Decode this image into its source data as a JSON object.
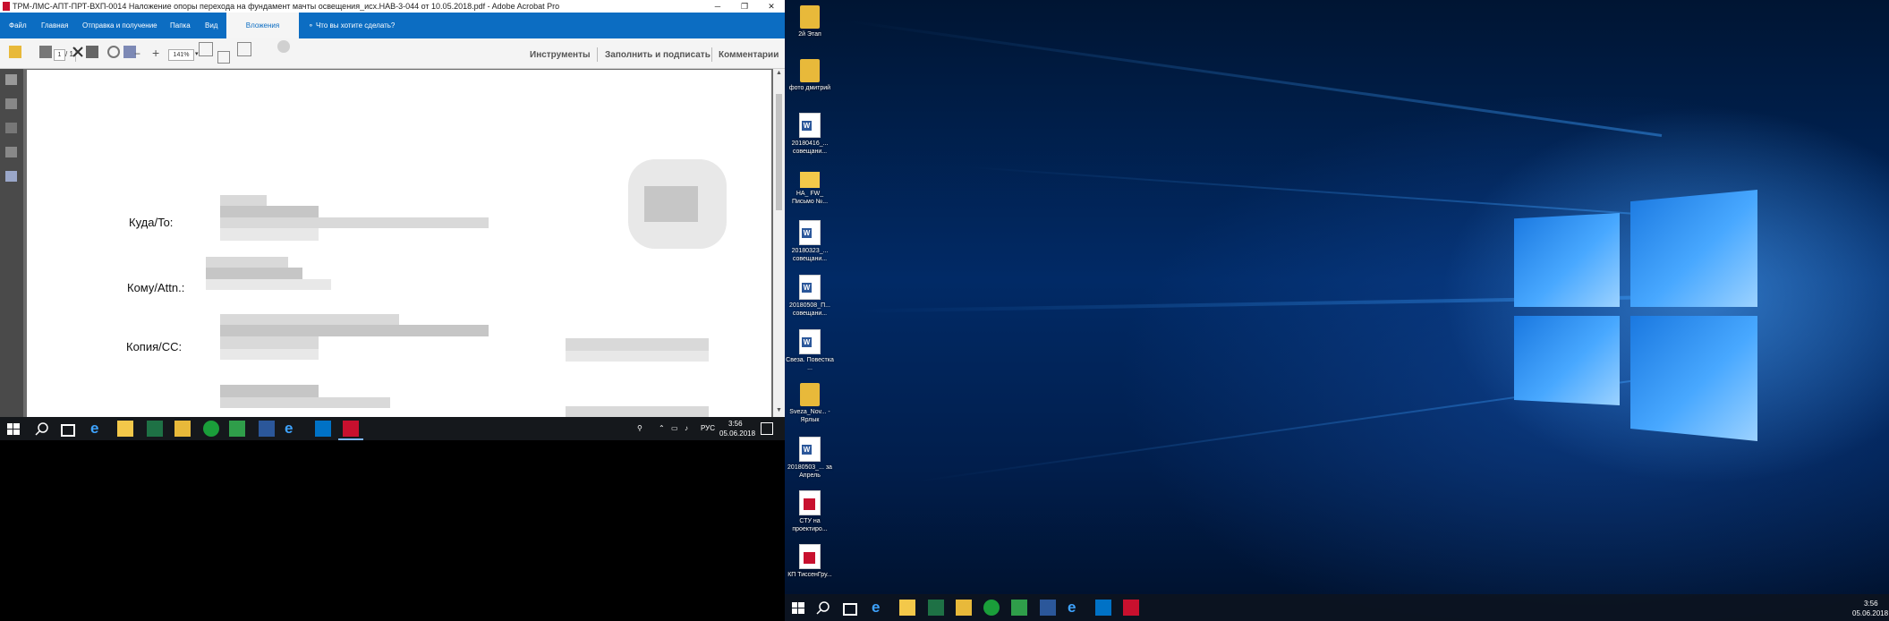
{
  "acrobat": {
    "title": "ТРМ-ЛМС-АПТ-ПРТ-ВХП-0014 Наложение опоры перехода на фундамент мачты освещения_исх.НАВ-3-044 от 10.05.2018.pdf - Adobe Acrobat Pro",
    "menu": [
      "Файл",
      "Главная",
      "Отправка и получение",
      "Папка",
      "Вид",
      "Вложения"
    ],
    "active_tab": "Вложения",
    "help_search": "Что вы хотите сделать?",
    "page_count": "/ 1",
    "zoom": "141%",
    "panels": [
      "Инструменты",
      "Заполнить и подписать",
      "Комментарии"
    ],
    "doc_labels": {
      "to": "Куда/To:",
      "attn": "Кому/Attn.:",
      "cc": "Копия/CC:"
    }
  },
  "left_taskbar": {
    "lang": "РУС",
    "time": "3:56",
    "date": "05.06.2018"
  },
  "desktop_icons": [
    {
      "icon": "folder-icon",
      "label": "2й Этап"
    },
    {
      "icon": "folder-icon",
      "label": "фото дмитрий"
    },
    {
      "icon": "word-doc-icon",
      "label": "20180416_... совещани..."
    },
    {
      "icon": "mail-icon",
      "label": "НА_ FW_ Письмо №..."
    },
    {
      "icon": "word-doc-icon",
      "label": "20180323_... совещани..."
    },
    {
      "icon": "word-doc-icon",
      "label": "20180508_П... совещани..."
    },
    {
      "icon": "word-doc-icon",
      "label": "Свеза. Повестка ..."
    },
    {
      "icon": "folder-icon",
      "label": "Sveza_Nov... - Ярлык"
    },
    {
      "icon": "word-doc-icon",
      "label": "20180503_... за Апрель"
    },
    {
      "icon": "pdf-icon",
      "label": "СТУ на проектиро..."
    },
    {
      "icon": "pdf-icon",
      "label": "КП ТиссенГру..."
    }
  ],
  "right_taskbar": {
    "time": "3:56",
    "date": "05.06.2018"
  },
  "colors": {
    "ribbon": "#0c6dc2",
    "taskbar": "#15181c",
    "win10_blue": "#48a8ff"
  }
}
